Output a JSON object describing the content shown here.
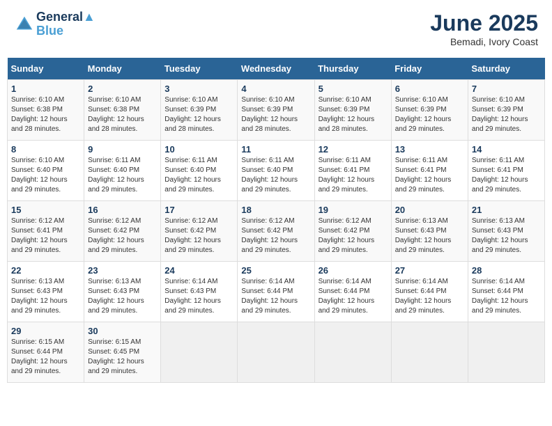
{
  "header": {
    "logo_line1": "General",
    "logo_line2": "Blue",
    "month_title": "June 2025",
    "location": "Bemadi, Ivory Coast"
  },
  "weekdays": [
    "Sunday",
    "Monday",
    "Tuesday",
    "Wednesday",
    "Thursday",
    "Friday",
    "Saturday"
  ],
  "weeks": [
    [
      {
        "day": "1",
        "sunrise": "6:10 AM",
        "sunset": "6:38 PM",
        "daylight": "12 hours and 28 minutes."
      },
      {
        "day": "2",
        "sunrise": "6:10 AM",
        "sunset": "6:38 PM",
        "daylight": "12 hours and 28 minutes."
      },
      {
        "day": "3",
        "sunrise": "6:10 AM",
        "sunset": "6:39 PM",
        "daylight": "12 hours and 28 minutes."
      },
      {
        "day": "4",
        "sunrise": "6:10 AM",
        "sunset": "6:39 PM",
        "daylight": "12 hours and 28 minutes."
      },
      {
        "day": "5",
        "sunrise": "6:10 AM",
        "sunset": "6:39 PM",
        "daylight": "12 hours and 28 minutes."
      },
      {
        "day": "6",
        "sunrise": "6:10 AM",
        "sunset": "6:39 PM",
        "daylight": "12 hours and 29 minutes."
      },
      {
        "day": "7",
        "sunrise": "6:10 AM",
        "sunset": "6:39 PM",
        "daylight": "12 hours and 29 minutes."
      }
    ],
    [
      {
        "day": "8",
        "sunrise": "6:10 AM",
        "sunset": "6:40 PM",
        "daylight": "12 hours and 29 minutes."
      },
      {
        "day": "9",
        "sunrise": "6:11 AM",
        "sunset": "6:40 PM",
        "daylight": "12 hours and 29 minutes."
      },
      {
        "day": "10",
        "sunrise": "6:11 AM",
        "sunset": "6:40 PM",
        "daylight": "12 hours and 29 minutes."
      },
      {
        "day": "11",
        "sunrise": "6:11 AM",
        "sunset": "6:40 PM",
        "daylight": "12 hours and 29 minutes."
      },
      {
        "day": "12",
        "sunrise": "6:11 AM",
        "sunset": "6:41 PM",
        "daylight": "12 hours and 29 minutes."
      },
      {
        "day": "13",
        "sunrise": "6:11 AM",
        "sunset": "6:41 PM",
        "daylight": "12 hours and 29 minutes."
      },
      {
        "day": "14",
        "sunrise": "6:11 AM",
        "sunset": "6:41 PM",
        "daylight": "12 hours and 29 minutes."
      }
    ],
    [
      {
        "day": "15",
        "sunrise": "6:12 AM",
        "sunset": "6:41 PM",
        "daylight": "12 hours and 29 minutes."
      },
      {
        "day": "16",
        "sunrise": "6:12 AM",
        "sunset": "6:42 PM",
        "daylight": "12 hours and 29 minutes."
      },
      {
        "day": "17",
        "sunrise": "6:12 AM",
        "sunset": "6:42 PM",
        "daylight": "12 hours and 29 minutes."
      },
      {
        "day": "18",
        "sunrise": "6:12 AM",
        "sunset": "6:42 PM",
        "daylight": "12 hours and 29 minutes."
      },
      {
        "day": "19",
        "sunrise": "6:12 AM",
        "sunset": "6:42 PM",
        "daylight": "12 hours and 29 minutes."
      },
      {
        "day": "20",
        "sunrise": "6:13 AM",
        "sunset": "6:43 PM",
        "daylight": "12 hours and 29 minutes."
      },
      {
        "day": "21",
        "sunrise": "6:13 AM",
        "sunset": "6:43 PM",
        "daylight": "12 hours and 29 minutes."
      }
    ],
    [
      {
        "day": "22",
        "sunrise": "6:13 AM",
        "sunset": "6:43 PM",
        "daylight": "12 hours and 29 minutes."
      },
      {
        "day": "23",
        "sunrise": "6:13 AM",
        "sunset": "6:43 PM",
        "daylight": "12 hours and 29 minutes."
      },
      {
        "day": "24",
        "sunrise": "6:14 AM",
        "sunset": "6:43 PM",
        "daylight": "12 hours and 29 minutes."
      },
      {
        "day": "25",
        "sunrise": "6:14 AM",
        "sunset": "6:44 PM",
        "daylight": "12 hours and 29 minutes."
      },
      {
        "day": "26",
        "sunrise": "6:14 AM",
        "sunset": "6:44 PM",
        "daylight": "12 hours and 29 minutes."
      },
      {
        "day": "27",
        "sunrise": "6:14 AM",
        "sunset": "6:44 PM",
        "daylight": "12 hours and 29 minutes."
      },
      {
        "day": "28",
        "sunrise": "6:14 AM",
        "sunset": "6:44 PM",
        "daylight": "12 hours and 29 minutes."
      }
    ],
    [
      {
        "day": "29",
        "sunrise": "6:15 AM",
        "sunset": "6:44 PM",
        "daylight": "12 hours and 29 minutes."
      },
      {
        "day": "30",
        "sunrise": "6:15 AM",
        "sunset": "6:45 PM",
        "daylight": "12 hours and 29 minutes."
      },
      null,
      null,
      null,
      null,
      null
    ]
  ],
  "labels": {
    "sunrise": "Sunrise:",
    "sunset": "Sunset:",
    "daylight": "Daylight:"
  }
}
